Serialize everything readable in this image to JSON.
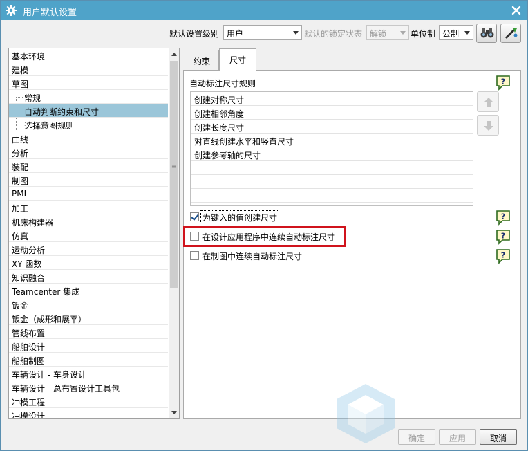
{
  "window": {
    "title": "用户默认设置"
  },
  "toolbar": {
    "level_label": "默认设置级别",
    "level_value": "用户",
    "lock_label": "默认的锁定状态",
    "lock_value": "解锁",
    "unit_label": "单位制",
    "unit_value": "公制"
  },
  "tree": {
    "items": [
      {
        "label": "基本环境"
      },
      {
        "label": "建模"
      },
      {
        "label": "草图"
      },
      {
        "label": "常规"
      },
      {
        "label": "自动判断约束和尺寸"
      },
      {
        "label": "选择意图规则"
      },
      {
        "label": "曲线"
      },
      {
        "label": "分析"
      },
      {
        "label": "装配"
      },
      {
        "label": "制图"
      },
      {
        "label": "PMI"
      },
      {
        "label": "加工"
      },
      {
        "label": "机床构建器"
      },
      {
        "label": "仿真"
      },
      {
        "label": "运动分析"
      },
      {
        "label": "XY 函数"
      },
      {
        "label": "知识融合"
      },
      {
        "label": "Teamcenter 集成"
      },
      {
        "label": "钣金"
      },
      {
        "label": "钣金（成形和展平）"
      },
      {
        "label": "管线布置"
      },
      {
        "label": "船舶设计"
      },
      {
        "label": "船舶制图"
      },
      {
        "label": "车辆设计 - 车身设计"
      },
      {
        "label": "车辆设计 - 总布置设计工具包"
      },
      {
        "label": "冲模工程"
      },
      {
        "label": "冲模设计"
      }
    ]
  },
  "tabs": [
    {
      "label": "约束"
    },
    {
      "label": "尺寸"
    }
  ],
  "panel": {
    "section_title": "自动标注尺寸规则",
    "rules": [
      {
        "label": "创建对称尺寸"
      },
      {
        "label": "创建相邻角度"
      },
      {
        "label": "创建长度尺寸"
      },
      {
        "label": "对直线创建水平和竖直尺寸"
      },
      {
        "label": "创建参考轴的尺寸"
      }
    ],
    "options": [
      {
        "label": "为键入的值创建尺寸",
        "checked": true
      },
      {
        "label": "在设计应用程序中连续自动标注尺寸",
        "checked": false
      },
      {
        "label": "在制图中连续自动标注尺寸",
        "checked": false
      }
    ]
  },
  "buttons": {
    "ok": "确定",
    "apply": "应用",
    "cancel": "取消"
  },
  "colors": {
    "title_bar": "#4fa3c9",
    "tree_selection": "#9bc6d9",
    "highlight_box": "#d0131c"
  }
}
